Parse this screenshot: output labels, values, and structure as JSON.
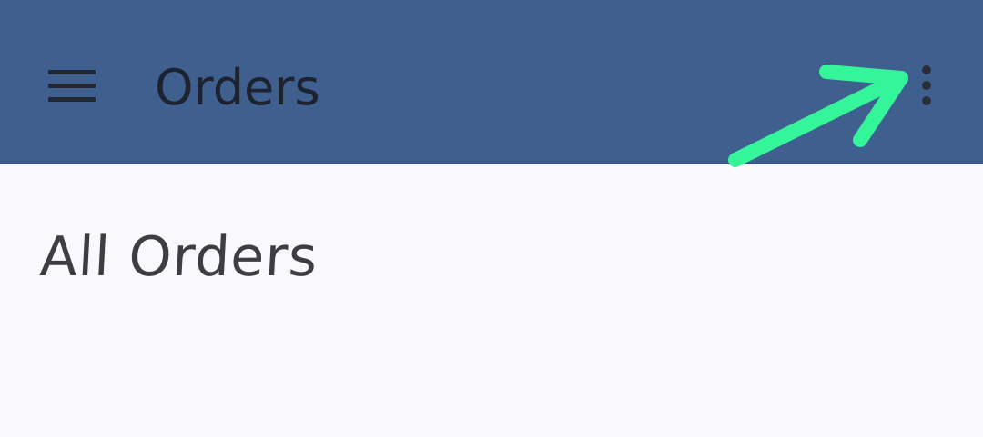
{
  "appbar": {
    "title": "Orders",
    "background_color": "#3f5f8f",
    "menu_icon": "hamburger-menu-icon",
    "overflow_icon": "more-vertical-icon"
  },
  "main": {
    "heading": "All Orders"
  },
  "annotation": {
    "type": "arrow",
    "color": "#35f59a",
    "points_to": "more-vertical-icon"
  }
}
